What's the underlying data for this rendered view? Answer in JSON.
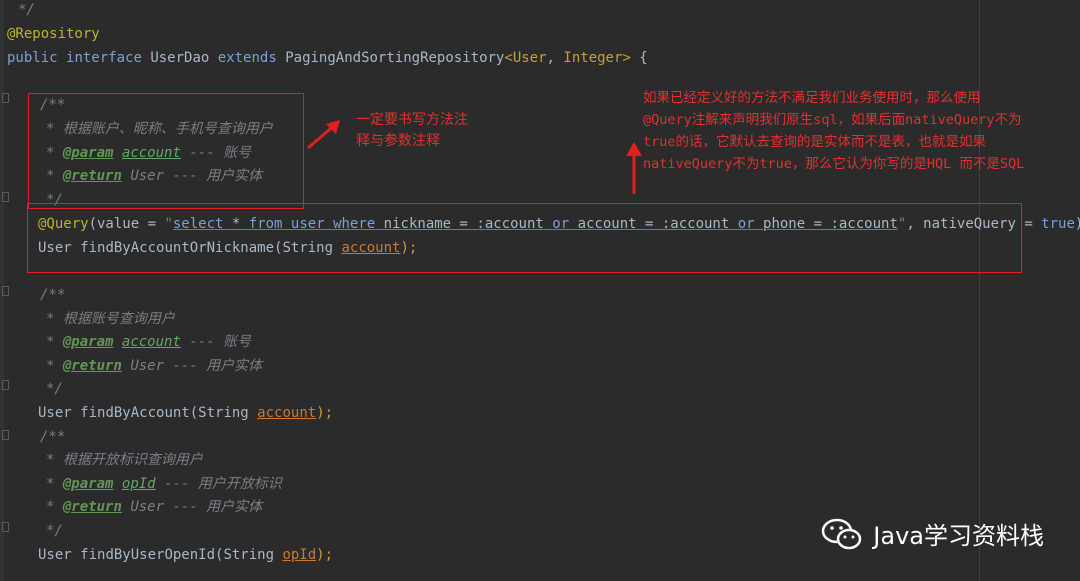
{
  "code": {
    "line0": "*/",
    "annotation_repository": "@Repository",
    "decl": {
      "kw_public": "public",
      "kw_interface": "interface",
      "name": "UserDao",
      "kw_extends": "extends",
      "parent": "PagingAndSortingRepository",
      "lt": "<",
      "t1": "User",
      "comma": ",",
      "t2": "Integer",
      "gt": ">",
      "brace": "{"
    },
    "doc1": {
      "open": "/**",
      "desc": "* 根据账户、昵称、手机号查询用户",
      "param_tag": "@param",
      "param_name": "account",
      "param_desc": "--- 账号",
      "return_tag": "@return",
      "return_desc": "User --- 用户实体",
      "close": "*/",
      "star": "*"
    },
    "query": {
      "anno": "@Query",
      "open": "(value = ",
      "quote": "\"",
      "sql_select": "select",
      "sql_star": "*",
      "sql_from": "from",
      "sql_user": "user",
      "sql_where": "where",
      "sql_cond1": "nickname = :account",
      "sql_or1": "or",
      "sql_cond2": "account = :account",
      "sql_or2": "or",
      "sql_cond3": "phone = :account",
      "tail": ", nativeQuery = ",
      "true": "true",
      "close": ")"
    },
    "m1": {
      "ret": "User",
      "name": "findByAccountOrNickname",
      "ptype": "(String ",
      "pname": "account",
      "end": ");"
    },
    "doc2": {
      "open": "/**",
      "desc": "* 根据账号查询用户",
      "param_tag": "@param",
      "param_name": "account",
      "param_desc": "--- 账号",
      "return_tag": "@return",
      "return_desc": "User --- 用户实体",
      "close": "*/",
      "star": "*"
    },
    "m2": {
      "ret": "User",
      "name": "findByAccount",
      "ptype": "(String ",
      "pname": "account",
      "end": ");"
    },
    "doc3": {
      "open": "/**",
      "desc": "* 根据开放标识查询用户",
      "param_tag": "@param",
      "param_name": "opId",
      "param_desc": "--- 用户开放标识",
      "return_tag": "@return",
      "return_desc": "User --- 用户实体",
      "close": "*/",
      "star": "*"
    },
    "m3": {
      "ret": "User",
      "name": "findByUserOpenId",
      "ptype": "(String ",
      "pname": "opId",
      "end": ");"
    }
  },
  "notes": {
    "left_line1": "一定要书写方法注",
    "left_line2": "释与参数注释",
    "right_line1": "如果已经定义好的方法不满足我们业务使用时，那么使用",
    "right_line2": "@Query注解来声明我们原生sql，如果后面nativeQuery不为",
    "right_line3": "true的话，它默认去查询的是实体而不是表，也就是如果",
    "right_line4": "nativeQuery不为true，那么它认为你写的是HQL 而不是SQL"
  },
  "watermark": {
    "text": "Java学习资料栈",
    "icon": "wechat-icon"
  },
  "colors": {
    "background": "#2b2b2b",
    "highlight_box": "#e02020",
    "note_text": "#e23030"
  }
}
